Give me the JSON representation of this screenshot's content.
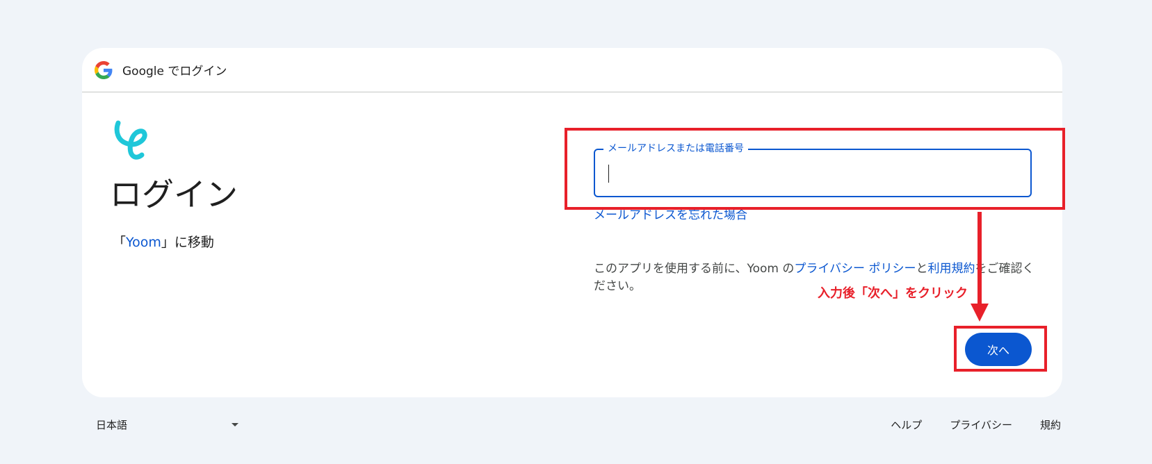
{
  "header": {
    "title": "Google でログイン"
  },
  "left": {
    "heading": "ログイン",
    "subtitle_prefix": "「",
    "app_name": "Yoom",
    "subtitle_suffix": "」に移動"
  },
  "form": {
    "email_label": "メールアドレスまたは電話番号",
    "email_value": "",
    "forgot_email": "メールアドレスを忘れた場合",
    "consent_prefix": "このアプリを使用する前に、Yoom の",
    "privacy_link": "プライバシー ポリシー",
    "consent_and": "と",
    "terms_link": "利用規約",
    "consent_suffix": "をご確認ください。",
    "next_button": "次へ"
  },
  "annotation": {
    "text": "入力後「次へ」をクリック",
    "color": "#e8202a"
  },
  "footer": {
    "language": "日本語",
    "links": [
      "ヘルプ",
      "プライバシー",
      "規約"
    ]
  },
  "colors": {
    "background": "#f0f4f9",
    "accent": "#0b57d0",
    "app_logo": "#1fc7d9"
  }
}
